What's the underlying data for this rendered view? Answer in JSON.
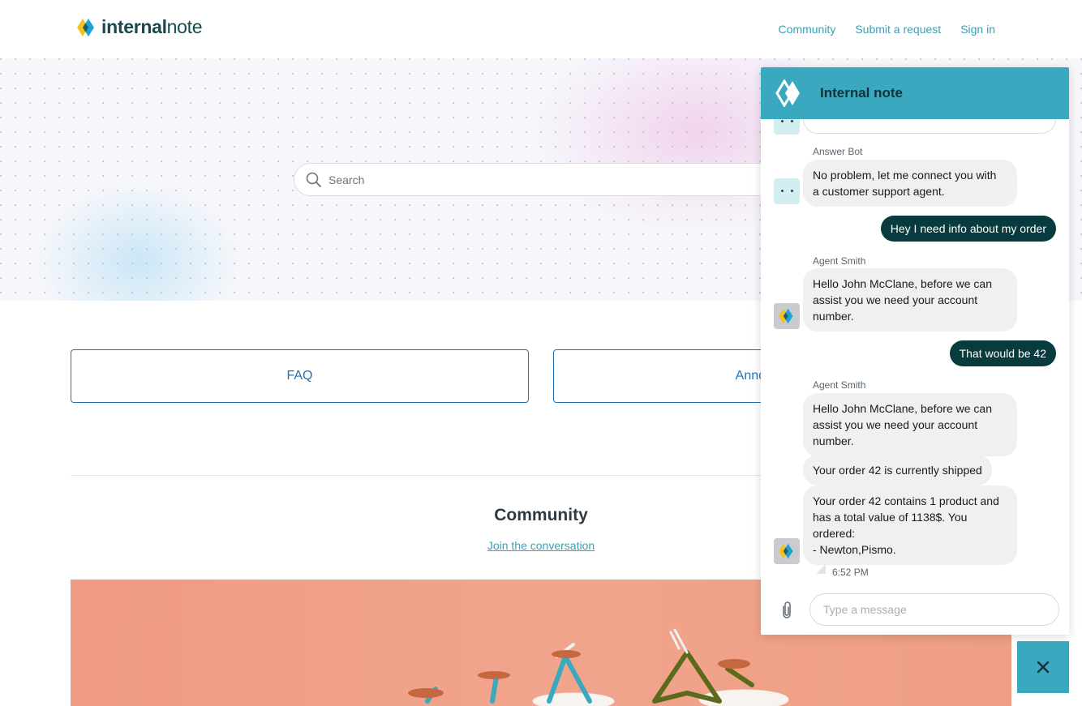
{
  "header": {
    "logo_bold": "internal",
    "logo_light": "note",
    "nav": [
      {
        "label": "Community"
      },
      {
        "label": "Submit a request"
      },
      {
        "label": "Sign in"
      }
    ]
  },
  "hero": {
    "search_placeholder": "Search"
  },
  "cards": [
    {
      "label": "FAQ"
    },
    {
      "label": "Announcements"
    }
  ],
  "community": {
    "title": "Community",
    "link": "Join the conversation"
  },
  "widget": {
    "title": "Internal note",
    "messages": [
      {
        "sender": "Answer Bot",
        "text": "No problem, let me connect you with\na customer support agent."
      },
      {
        "mine": "Hey I need info about my order"
      },
      {
        "sender": "Agent Smith",
        "text": "Hello John McClane, before we can\nassist you we need your account\nnumber."
      },
      {
        "mine": "That would be 42"
      },
      {
        "sender": "Agent Smith",
        "text": "Hello John McClane, before we can\nassist you we need your account\nnumber."
      },
      {
        "text": "Your order 42 is currently shipped"
      },
      {
        "text": "Your order 42 contains 1 product and\nhas a total value of 1138$. You\nordered:\n- Newton,Pismo."
      }
    ],
    "timestamp": "6:52 PM",
    "input_placeholder": "Type a message",
    "close_label": "×"
  },
  "colors": {
    "brand_teal": "#3aa9bf",
    "mine_bubble": "#073b3e",
    "link_blue": "#1f73b7"
  }
}
